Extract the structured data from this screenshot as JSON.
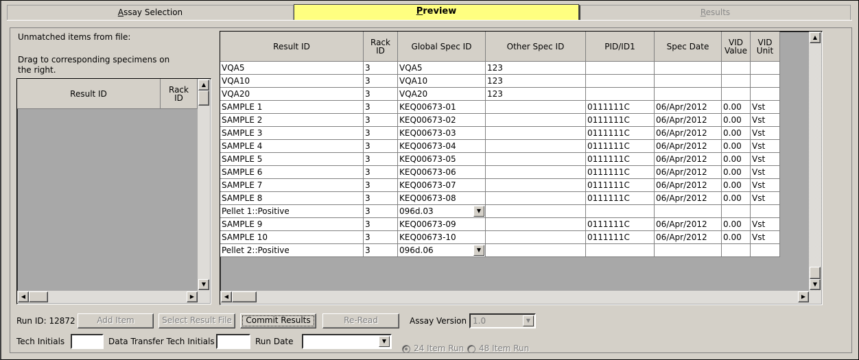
{
  "tabs": [
    {
      "label": "Assay Selection",
      "underline": "A"
    },
    {
      "label": "Preview",
      "underline": "P"
    },
    {
      "label": "Results",
      "underline": "R"
    }
  ],
  "left_panel": {
    "title": "Unmatched items from file:",
    "instruction_line1": "Drag to corresponding specimens on",
    "instruction_line2": "the right.",
    "columns": [
      "Result ID",
      "Rack\nID"
    ]
  },
  "main_grid": {
    "columns": [
      "Result ID",
      "Rack\nID",
      "Global Spec ID",
      "Other Spec ID",
      "PID/ID1",
      "Spec Date",
      "VID\nValue",
      "VID\nUnit"
    ],
    "rows": [
      {
        "result_id": "VQA5",
        "rack": "3",
        "global": "VQA5",
        "other": "123",
        "pid": "",
        "date": "",
        "vid_value": "",
        "vid_unit": "",
        "dropdown": false
      },
      {
        "result_id": "VQA10",
        "rack": "3",
        "global": "VQA10",
        "other": "123",
        "pid": "",
        "date": "",
        "vid_value": "",
        "vid_unit": "",
        "dropdown": false
      },
      {
        "result_id": "VQA20",
        "rack": "3",
        "global": "VQA20",
        "other": "123",
        "pid": "",
        "date": "",
        "vid_value": "",
        "vid_unit": "",
        "dropdown": false
      },
      {
        "result_id": "SAMPLE 1",
        "rack": "3",
        "global": "KEQ00673-01",
        "other": "",
        "pid": "0111111C",
        "date": "06/Apr/2012",
        "vid_value": "0.00",
        "vid_unit": "Vst",
        "dropdown": false
      },
      {
        "result_id": "SAMPLE 2",
        "rack": "3",
        "global": "KEQ00673-02",
        "other": "",
        "pid": "0111111C",
        "date": "06/Apr/2012",
        "vid_value": "0.00",
        "vid_unit": "Vst",
        "dropdown": false
      },
      {
        "result_id": "SAMPLE 3",
        "rack": "3",
        "global": "KEQ00673-03",
        "other": "",
        "pid": "0111111C",
        "date": "06/Apr/2012",
        "vid_value": "0.00",
        "vid_unit": "Vst",
        "dropdown": false
      },
      {
        "result_id": "SAMPLE 4",
        "rack": "3",
        "global": "KEQ00673-04",
        "other": "",
        "pid": "0111111C",
        "date": "06/Apr/2012",
        "vid_value": "0.00",
        "vid_unit": "Vst",
        "dropdown": false
      },
      {
        "result_id": "SAMPLE 5",
        "rack": "3",
        "global": "KEQ00673-05",
        "other": "",
        "pid": "0111111C",
        "date": "06/Apr/2012",
        "vid_value": "0.00",
        "vid_unit": "Vst",
        "dropdown": false
      },
      {
        "result_id": "SAMPLE 6",
        "rack": "3",
        "global": "KEQ00673-06",
        "other": "",
        "pid": "0111111C",
        "date": "06/Apr/2012",
        "vid_value": "0.00",
        "vid_unit": "Vst",
        "dropdown": false
      },
      {
        "result_id": "SAMPLE 7",
        "rack": "3",
        "global": "KEQ00673-07",
        "other": "",
        "pid": "0111111C",
        "date": "06/Apr/2012",
        "vid_value": "0.00",
        "vid_unit": "Vst",
        "dropdown": false
      },
      {
        "result_id": "SAMPLE 8",
        "rack": "3",
        "global": "KEQ00673-08",
        "other": "",
        "pid": "0111111C",
        "date": "06/Apr/2012",
        "vid_value": "0.00",
        "vid_unit": "Vst",
        "dropdown": false
      },
      {
        "result_id": "Pellet 1::Positive",
        "rack": "3",
        "global": "096d.03",
        "other": "",
        "pid": "",
        "date": "",
        "vid_value": "",
        "vid_unit": "",
        "dropdown": true
      },
      {
        "result_id": "SAMPLE 9",
        "rack": "3",
        "global": "KEQ00673-09",
        "other": "",
        "pid": "0111111C",
        "date": "06/Apr/2012",
        "vid_value": "0.00",
        "vid_unit": "Vst",
        "dropdown": false
      },
      {
        "result_id": "SAMPLE 10",
        "rack": "3",
        "global": "KEQ00673-10",
        "other": "",
        "pid": "0111111C",
        "date": "06/Apr/2012",
        "vid_value": "0.00",
        "vid_unit": "Vst",
        "dropdown": false
      },
      {
        "result_id": "Pellet 2::Positive",
        "rack": "3",
        "global": "096d.06",
        "other": "",
        "pid": "",
        "date": "",
        "vid_value": "",
        "vid_unit": "",
        "dropdown": true
      }
    ]
  },
  "footer": {
    "run_id": "Run ID: 12872",
    "add_item": "Add Item",
    "select_result_file": "Select Result File",
    "commit_results": "Commit Results",
    "re_read": "Re-Read",
    "assay_version_label": "Assay Version",
    "assay_version_value": "1.0",
    "tech_initials_label": "Tech Initials",
    "tech_initials_value": "",
    "data_transfer_label": "Data Transfer Tech Initials",
    "data_transfer_value": "",
    "run_date_label": "Run Date",
    "run_date_value": "",
    "radio_24": "24 Item Run",
    "radio_48": "48 Item Run",
    "selected_run": "24 Item Run"
  },
  "icons": {
    "up": "up-arrow-icon",
    "down": "down-arrow-icon",
    "left": "left-arrow-icon",
    "right": "right-arrow-icon",
    "dropdown": "dropdown-arrow-icon"
  },
  "colors": {
    "active_tab": "#ffff80",
    "grid_bg": "#a8a8a8",
    "face": "#d4d0c8"
  }
}
